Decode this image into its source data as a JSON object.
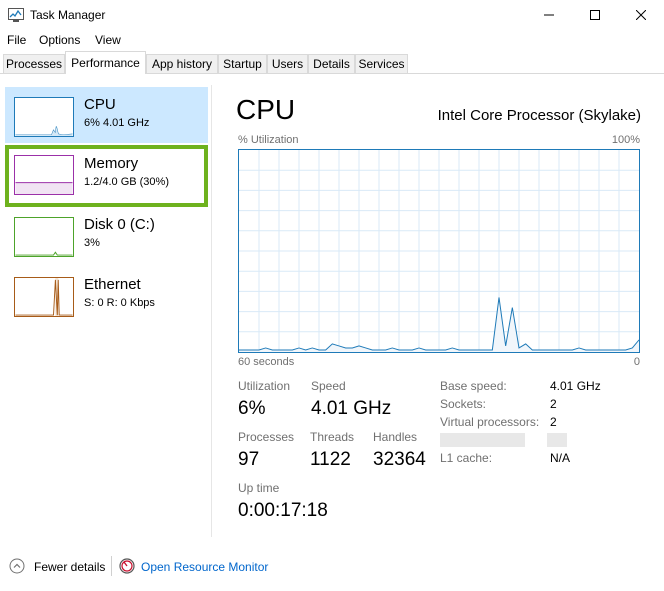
{
  "window": {
    "title": "Task Manager",
    "icon": "task-manager-icon"
  },
  "menu": [
    "File",
    "Options",
    "View"
  ],
  "tabs": [
    {
      "label": "Processes",
      "active": false
    },
    {
      "label": "Performance",
      "active": true
    },
    {
      "label": "App history",
      "active": false
    },
    {
      "label": "Startup",
      "active": false
    },
    {
      "label": "Users",
      "active": false
    },
    {
      "label": "Details",
      "active": false
    },
    {
      "label": "Services",
      "active": false
    }
  ],
  "sidebar": {
    "items": [
      {
        "name": "CPU",
        "detail": "6% 4.01 GHz",
        "color": "#1e7ab8",
        "selected": true,
        "highlighted": false
      },
      {
        "name": "Memory",
        "detail": "1.2/4.0 GB (30%)",
        "color": "#9b30a8",
        "selected": false,
        "highlighted": true
      },
      {
        "name": "Disk 0 (C:)",
        "detail": "3%",
        "color": "#4da32a",
        "selected": false,
        "highlighted": false
      },
      {
        "name": "Ethernet",
        "detail": "S: 0 R: 0 Kbps",
        "color": "#a75b18",
        "selected": false,
        "highlighted": false
      }
    ]
  },
  "main": {
    "title": "CPU",
    "model": "Intel Core Processor (Skylake)",
    "graph": {
      "top_left_label": "% Utilization",
      "top_right_label": "100%",
      "bottom_left_label": "60 seconds",
      "bottom_right_label": "0"
    },
    "stats": {
      "utilization_label": "Utilization",
      "utilization_value": "6%",
      "speed_label": "Speed",
      "speed_value": "4.01 GHz",
      "processes_label": "Processes",
      "processes_value": "97",
      "threads_label": "Threads",
      "threads_value": "1122",
      "handles_label": "Handles",
      "handles_value": "32364",
      "uptime_label": "Up time",
      "uptime_value": "0:00:17:18"
    },
    "info": {
      "base_speed_label": "Base speed:",
      "base_speed_value": "4.01 GHz",
      "sockets_label": "Sockets:",
      "sockets_value": "2",
      "virtual_processors_label": "Virtual processors:",
      "virtual_processors_value": "2",
      "l1_cache_label": "L1 cache:",
      "l1_cache_value": "N/A"
    }
  },
  "footer": {
    "fewer_details": "Fewer details",
    "open_resource_monitor": "Open Resource Monitor"
  },
  "chart_data": {
    "type": "line",
    "title": "",
    "xlabel": "60 seconds",
    "ylabel": "% Utilization",
    "xlim": [
      60,
      0
    ],
    "ylim": [
      0,
      100
    ],
    "grid": true,
    "series": [
      {
        "x": [
          60,
          59,
          58,
          57,
          56,
          55,
          54,
          53,
          52,
          51,
          50,
          49,
          48,
          47,
          46,
          45,
          44,
          43,
          42,
          41,
          40,
          39,
          38,
          37,
          36,
          35,
          34,
          33,
          32,
          31,
          30,
          29,
          28,
          27,
          26,
          25,
          24,
          23,
          22,
          21,
          20,
          19,
          18,
          17,
          16,
          15,
          14,
          13,
          12,
          11,
          10,
          9,
          8,
          7,
          6,
          5,
          4,
          3,
          2,
          1,
          0
        ],
        "values": [
          1,
          1,
          1,
          1,
          2,
          1,
          1,
          1,
          1,
          2,
          1,
          2,
          1,
          1,
          4,
          3,
          2,
          2,
          3,
          2,
          1,
          1,
          1,
          2,
          1,
          1,
          1,
          2,
          1,
          1,
          1,
          1,
          2,
          1,
          1,
          1,
          1,
          1,
          1,
          27,
          3,
          22,
          2,
          4,
          1,
          1,
          1,
          1,
          1,
          1,
          1,
          2,
          1,
          1,
          1,
          1,
          1,
          1,
          1,
          2,
          6
        ]
      }
    ]
  }
}
